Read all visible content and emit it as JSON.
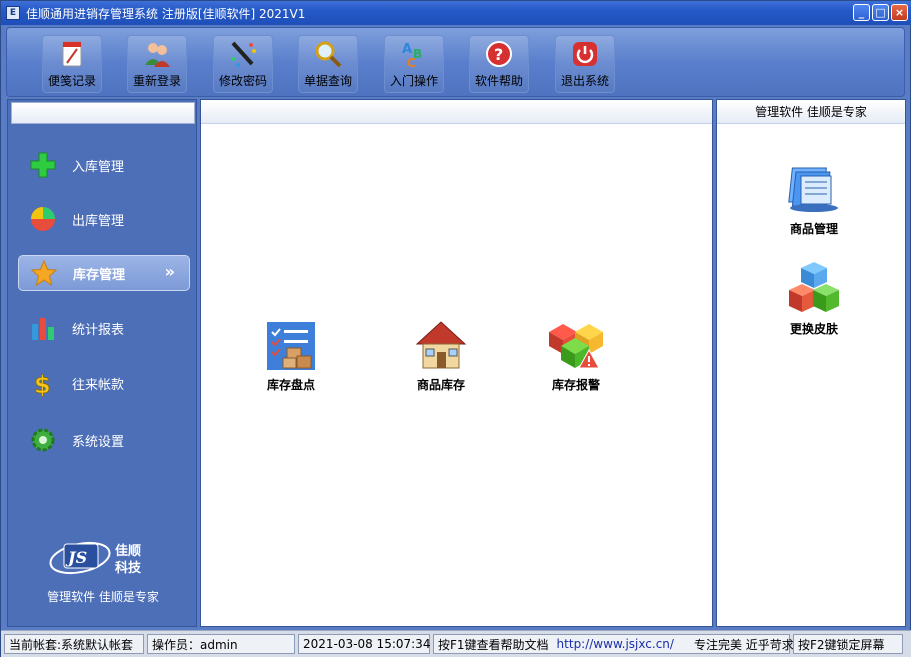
{
  "window": {
    "title": "佳顺通用进销存管理系统 注册版[佳顺软件] 2021V1",
    "app_icon_glyph": "E",
    "min_glyph": "_",
    "max_glyph": "□",
    "close_glyph": "×"
  },
  "toolbar": {
    "items": [
      {
        "label": "便笺记录",
        "icon": "notepad-icon"
      },
      {
        "label": "重新登录",
        "icon": "users-icon"
      },
      {
        "label": "修改密码",
        "icon": "pencil-icon"
      },
      {
        "label": "单据查询",
        "icon": "magnifier-icon"
      },
      {
        "label": "入门操作",
        "icon": "abc-icon"
      },
      {
        "label": "软件帮助",
        "icon": "help-icon"
      },
      {
        "label": "退出系统",
        "icon": "power-icon"
      }
    ]
  },
  "sidebar": {
    "items": [
      {
        "label": "入库管理",
        "icon": "plus-icon"
      },
      {
        "label": "出库管理",
        "icon": "pie-icon"
      },
      {
        "label": "库存管理",
        "icon": "star-icon",
        "active": true
      },
      {
        "label": "统计报表",
        "icon": "bar-chart-icon"
      },
      {
        "label": "往来帐款",
        "icon": "dollar-icon"
      },
      {
        "label": "系统设置",
        "icon": "gear-icon"
      }
    ],
    "active_chevron": "»",
    "logo_mark": "JS",
    "logo_text_1": "佳顺",
    "logo_text_2": "科技",
    "slogan": "管理软件 佳顺是专家"
  },
  "center": {
    "modules": [
      {
        "label": "库存盘点",
        "icon": "inventory-check-icon"
      },
      {
        "label": "商品库存",
        "icon": "house-icon"
      },
      {
        "label": "库存报警",
        "icon": "alarm-boxes-icon"
      }
    ]
  },
  "right": {
    "header": "管理软件 佳顺是专家",
    "modules": [
      {
        "label": "商品管理",
        "icon": "files-icon"
      },
      {
        "label": "更换皮肤",
        "icon": "cubes-icon"
      }
    ]
  },
  "statusbar": {
    "account": "当前帐套:系统默认帐套",
    "operator": "操作员：admin",
    "datetime": "2021-03-08 15:07:34",
    "help_hint": "按F1键查看帮助文档",
    "url": "http://www.jsjxc.cn/",
    "motto": "专注完美 近乎苛求",
    "lock_hint": "按F2键锁定屏幕"
  }
}
